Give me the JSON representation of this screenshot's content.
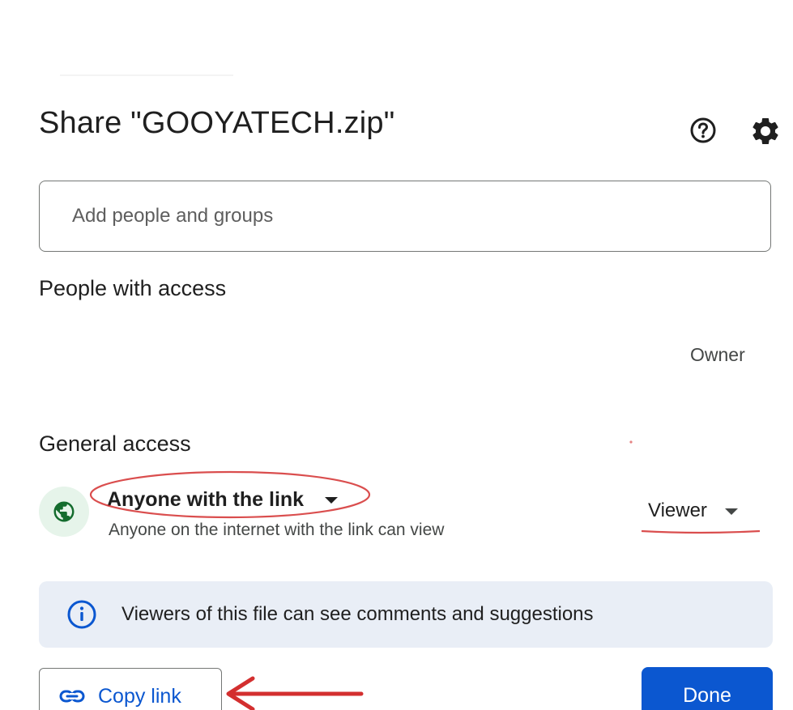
{
  "dialog": {
    "title": "Share \"GOOYATECH.zip\"",
    "help_icon": "help-circle-icon",
    "settings_icon": "gear-icon"
  },
  "add_people": {
    "placeholder": "Add people and groups",
    "value": ""
  },
  "people_with_access": {
    "heading": "People with access",
    "entries": [
      {
        "role": "Owner"
      }
    ]
  },
  "general_access": {
    "heading": "General access",
    "icon": "globe-icon",
    "access_level": "Anyone with the link",
    "description": "Anyone on the internet with the link can view",
    "role": "Viewer"
  },
  "info_banner": {
    "icon": "info-icon",
    "text": "Viewers of this file can see comments and suggestions"
  },
  "footer": {
    "copy_link_icon": "link-icon",
    "copy_link_label": "Copy link",
    "done_label": "Done"
  },
  "colors": {
    "primary": "#0b57d0",
    "banner_bg": "#e9eef6",
    "globe_bg": "#e6f4ea",
    "globe_fg": "#146c2e",
    "annotation": "#d32f2f"
  }
}
